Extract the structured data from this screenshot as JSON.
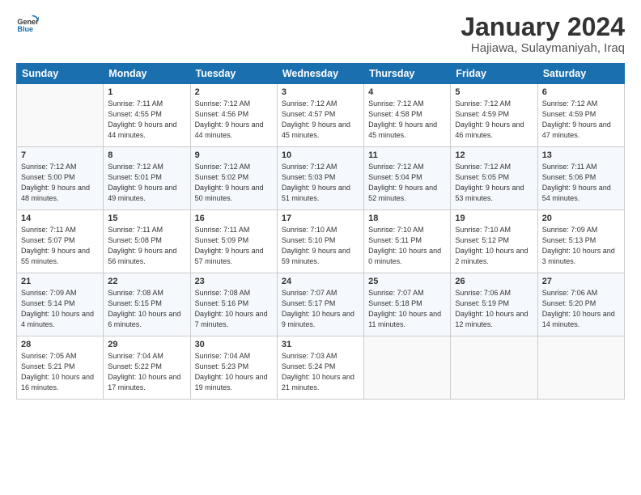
{
  "logo": {
    "text_general": "General",
    "text_blue": "Blue"
  },
  "title": "January 2024",
  "subtitle": "Hajiawa, Sulaymaniyah, Iraq",
  "days_of_week": [
    "Sunday",
    "Monday",
    "Tuesday",
    "Wednesday",
    "Thursday",
    "Friday",
    "Saturday"
  ],
  "weeks": [
    [
      {
        "day": "",
        "sunrise": "",
        "sunset": "",
        "daylight": ""
      },
      {
        "day": "1",
        "sunrise": "Sunrise: 7:11 AM",
        "sunset": "Sunset: 4:55 PM",
        "daylight": "Daylight: 9 hours and 44 minutes."
      },
      {
        "day": "2",
        "sunrise": "Sunrise: 7:12 AM",
        "sunset": "Sunset: 4:56 PM",
        "daylight": "Daylight: 9 hours and 44 minutes."
      },
      {
        "day": "3",
        "sunrise": "Sunrise: 7:12 AM",
        "sunset": "Sunset: 4:57 PM",
        "daylight": "Daylight: 9 hours and 45 minutes."
      },
      {
        "day": "4",
        "sunrise": "Sunrise: 7:12 AM",
        "sunset": "Sunset: 4:58 PM",
        "daylight": "Daylight: 9 hours and 45 minutes."
      },
      {
        "day": "5",
        "sunrise": "Sunrise: 7:12 AM",
        "sunset": "Sunset: 4:59 PM",
        "daylight": "Daylight: 9 hours and 46 minutes."
      },
      {
        "day": "6",
        "sunrise": "Sunrise: 7:12 AM",
        "sunset": "Sunset: 4:59 PM",
        "daylight": "Daylight: 9 hours and 47 minutes."
      }
    ],
    [
      {
        "day": "7",
        "sunrise": "Sunrise: 7:12 AM",
        "sunset": "Sunset: 5:00 PM",
        "daylight": "Daylight: 9 hours and 48 minutes."
      },
      {
        "day": "8",
        "sunrise": "Sunrise: 7:12 AM",
        "sunset": "Sunset: 5:01 PM",
        "daylight": "Daylight: 9 hours and 49 minutes."
      },
      {
        "day": "9",
        "sunrise": "Sunrise: 7:12 AM",
        "sunset": "Sunset: 5:02 PM",
        "daylight": "Daylight: 9 hours and 50 minutes."
      },
      {
        "day": "10",
        "sunrise": "Sunrise: 7:12 AM",
        "sunset": "Sunset: 5:03 PM",
        "daylight": "Daylight: 9 hours and 51 minutes."
      },
      {
        "day": "11",
        "sunrise": "Sunrise: 7:12 AM",
        "sunset": "Sunset: 5:04 PM",
        "daylight": "Daylight: 9 hours and 52 minutes."
      },
      {
        "day": "12",
        "sunrise": "Sunrise: 7:12 AM",
        "sunset": "Sunset: 5:05 PM",
        "daylight": "Daylight: 9 hours and 53 minutes."
      },
      {
        "day": "13",
        "sunrise": "Sunrise: 7:11 AM",
        "sunset": "Sunset: 5:06 PM",
        "daylight": "Daylight: 9 hours and 54 minutes."
      }
    ],
    [
      {
        "day": "14",
        "sunrise": "Sunrise: 7:11 AM",
        "sunset": "Sunset: 5:07 PM",
        "daylight": "Daylight: 9 hours and 55 minutes."
      },
      {
        "day": "15",
        "sunrise": "Sunrise: 7:11 AM",
        "sunset": "Sunset: 5:08 PM",
        "daylight": "Daylight: 9 hours and 56 minutes."
      },
      {
        "day": "16",
        "sunrise": "Sunrise: 7:11 AM",
        "sunset": "Sunset: 5:09 PM",
        "daylight": "Daylight: 9 hours and 57 minutes."
      },
      {
        "day": "17",
        "sunrise": "Sunrise: 7:10 AM",
        "sunset": "Sunset: 5:10 PM",
        "daylight": "Daylight: 9 hours and 59 minutes."
      },
      {
        "day": "18",
        "sunrise": "Sunrise: 7:10 AM",
        "sunset": "Sunset: 5:11 PM",
        "daylight": "Daylight: 10 hours and 0 minutes."
      },
      {
        "day": "19",
        "sunrise": "Sunrise: 7:10 AM",
        "sunset": "Sunset: 5:12 PM",
        "daylight": "Daylight: 10 hours and 2 minutes."
      },
      {
        "day": "20",
        "sunrise": "Sunrise: 7:09 AM",
        "sunset": "Sunset: 5:13 PM",
        "daylight": "Daylight: 10 hours and 3 minutes."
      }
    ],
    [
      {
        "day": "21",
        "sunrise": "Sunrise: 7:09 AM",
        "sunset": "Sunset: 5:14 PM",
        "daylight": "Daylight: 10 hours and 4 minutes."
      },
      {
        "day": "22",
        "sunrise": "Sunrise: 7:08 AM",
        "sunset": "Sunset: 5:15 PM",
        "daylight": "Daylight: 10 hours and 6 minutes."
      },
      {
        "day": "23",
        "sunrise": "Sunrise: 7:08 AM",
        "sunset": "Sunset: 5:16 PM",
        "daylight": "Daylight: 10 hours and 7 minutes."
      },
      {
        "day": "24",
        "sunrise": "Sunrise: 7:07 AM",
        "sunset": "Sunset: 5:17 PM",
        "daylight": "Daylight: 10 hours and 9 minutes."
      },
      {
        "day": "25",
        "sunrise": "Sunrise: 7:07 AM",
        "sunset": "Sunset: 5:18 PM",
        "daylight": "Daylight: 10 hours and 11 minutes."
      },
      {
        "day": "26",
        "sunrise": "Sunrise: 7:06 AM",
        "sunset": "Sunset: 5:19 PM",
        "daylight": "Daylight: 10 hours and 12 minutes."
      },
      {
        "day": "27",
        "sunrise": "Sunrise: 7:06 AM",
        "sunset": "Sunset: 5:20 PM",
        "daylight": "Daylight: 10 hours and 14 minutes."
      }
    ],
    [
      {
        "day": "28",
        "sunrise": "Sunrise: 7:05 AM",
        "sunset": "Sunset: 5:21 PM",
        "daylight": "Daylight: 10 hours and 16 minutes."
      },
      {
        "day": "29",
        "sunrise": "Sunrise: 7:04 AM",
        "sunset": "Sunset: 5:22 PM",
        "daylight": "Daylight: 10 hours and 17 minutes."
      },
      {
        "day": "30",
        "sunrise": "Sunrise: 7:04 AM",
        "sunset": "Sunset: 5:23 PM",
        "daylight": "Daylight: 10 hours and 19 minutes."
      },
      {
        "day": "31",
        "sunrise": "Sunrise: 7:03 AM",
        "sunset": "Sunset: 5:24 PM",
        "daylight": "Daylight: 10 hours and 21 minutes."
      },
      {
        "day": "",
        "sunrise": "",
        "sunset": "",
        "daylight": ""
      },
      {
        "day": "",
        "sunrise": "",
        "sunset": "",
        "daylight": ""
      },
      {
        "day": "",
        "sunrise": "",
        "sunset": "",
        "daylight": ""
      }
    ]
  ]
}
